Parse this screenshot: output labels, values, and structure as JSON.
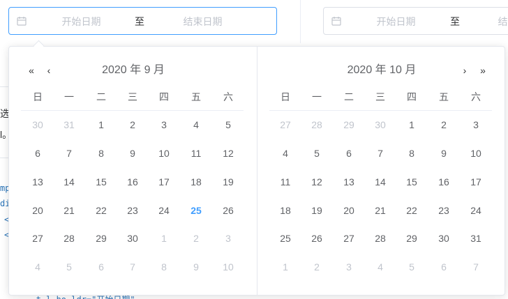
{
  "range_left": {
    "start_placeholder": "开始日期",
    "separator": "至",
    "end_placeholder": "结束日期"
  },
  "range_right": {
    "start_placeholder": "开始日期",
    "separator": "至",
    "end_placeholder": "结束日期"
  },
  "background": {
    "snippet_1": "选",
    "snippet_2": "l。",
    "snippet_3": "mp",
    "snippet_4": "di",
    "snippet_5": "<",
    "snippet_6": "<",
    "snippet_7": "...t.l.ho.ldr=\"开始日期\""
  },
  "calendar": {
    "left_title": "2020 年 9 月",
    "right_title": "2020 年 10 月",
    "week_days": [
      "日",
      "一",
      "二",
      "三",
      "四",
      "五",
      "六"
    ],
    "nav": {
      "prev_year": "«",
      "prev_month": "‹",
      "next_month": "›",
      "next_year": "»"
    },
    "left_rows": [
      [
        {
          "d": "30",
          "s": "out"
        },
        {
          "d": "31",
          "s": "out"
        },
        {
          "d": "1",
          "s": ""
        },
        {
          "d": "2",
          "s": ""
        },
        {
          "d": "3",
          "s": ""
        },
        {
          "d": "4",
          "s": ""
        },
        {
          "d": "5",
          "s": ""
        }
      ],
      [
        {
          "d": "6",
          "s": ""
        },
        {
          "d": "7",
          "s": ""
        },
        {
          "d": "8",
          "s": ""
        },
        {
          "d": "9",
          "s": ""
        },
        {
          "d": "10",
          "s": ""
        },
        {
          "d": "11",
          "s": ""
        },
        {
          "d": "12",
          "s": ""
        }
      ],
      [
        {
          "d": "13",
          "s": ""
        },
        {
          "d": "14",
          "s": ""
        },
        {
          "d": "15",
          "s": ""
        },
        {
          "d": "16",
          "s": ""
        },
        {
          "d": "17",
          "s": ""
        },
        {
          "d": "18",
          "s": ""
        },
        {
          "d": "19",
          "s": ""
        }
      ],
      [
        {
          "d": "20",
          "s": ""
        },
        {
          "d": "21",
          "s": ""
        },
        {
          "d": "22",
          "s": ""
        },
        {
          "d": "23",
          "s": ""
        },
        {
          "d": "24",
          "s": ""
        },
        {
          "d": "25",
          "s": "today"
        },
        {
          "d": "26",
          "s": ""
        }
      ],
      [
        {
          "d": "27",
          "s": ""
        },
        {
          "d": "28",
          "s": ""
        },
        {
          "d": "29",
          "s": ""
        },
        {
          "d": "30",
          "s": ""
        },
        {
          "d": "1",
          "s": "out"
        },
        {
          "d": "2",
          "s": "out"
        },
        {
          "d": "3",
          "s": "out"
        }
      ],
      [
        {
          "d": "4",
          "s": "out"
        },
        {
          "d": "5",
          "s": "out"
        },
        {
          "d": "6",
          "s": "out"
        },
        {
          "d": "7",
          "s": "out"
        },
        {
          "d": "8",
          "s": "out"
        },
        {
          "d": "9",
          "s": "out"
        },
        {
          "d": "10",
          "s": "out"
        }
      ]
    ],
    "right_rows": [
      [
        {
          "d": "27",
          "s": "out"
        },
        {
          "d": "28",
          "s": "out"
        },
        {
          "d": "29",
          "s": "out"
        },
        {
          "d": "30",
          "s": "out"
        },
        {
          "d": "1",
          "s": ""
        },
        {
          "d": "2",
          "s": ""
        },
        {
          "d": "3",
          "s": ""
        }
      ],
      [
        {
          "d": "4",
          "s": ""
        },
        {
          "d": "5",
          "s": ""
        },
        {
          "d": "6",
          "s": ""
        },
        {
          "d": "7",
          "s": ""
        },
        {
          "d": "8",
          "s": ""
        },
        {
          "d": "9",
          "s": ""
        },
        {
          "d": "10",
          "s": ""
        }
      ],
      [
        {
          "d": "11",
          "s": ""
        },
        {
          "d": "12",
          "s": ""
        },
        {
          "d": "13",
          "s": ""
        },
        {
          "d": "14",
          "s": ""
        },
        {
          "d": "15",
          "s": ""
        },
        {
          "d": "16",
          "s": ""
        },
        {
          "d": "17",
          "s": ""
        }
      ],
      [
        {
          "d": "18",
          "s": ""
        },
        {
          "d": "19",
          "s": ""
        },
        {
          "d": "20",
          "s": ""
        },
        {
          "d": "21",
          "s": ""
        },
        {
          "d": "22",
          "s": ""
        },
        {
          "d": "23",
          "s": ""
        },
        {
          "d": "24",
          "s": ""
        }
      ],
      [
        {
          "d": "25",
          "s": ""
        },
        {
          "d": "26",
          "s": ""
        },
        {
          "d": "27",
          "s": ""
        },
        {
          "d": "28",
          "s": ""
        },
        {
          "d": "29",
          "s": ""
        },
        {
          "d": "30",
          "s": ""
        },
        {
          "d": "31",
          "s": ""
        }
      ],
      [
        {
          "d": "1",
          "s": "out"
        },
        {
          "d": "2",
          "s": "out"
        },
        {
          "d": "3",
          "s": "out"
        },
        {
          "d": "4",
          "s": "out"
        },
        {
          "d": "5",
          "s": "out"
        },
        {
          "d": "6",
          "s": "out"
        },
        {
          "d": "7",
          "s": "out"
        }
      ]
    ]
  },
  "colors": {
    "accent": "#409eff",
    "text": "#606266",
    "muted": "#c0c4cc",
    "border": "#dcdfe6"
  },
  "icons": {
    "range_icon": "calendar-icon"
  }
}
